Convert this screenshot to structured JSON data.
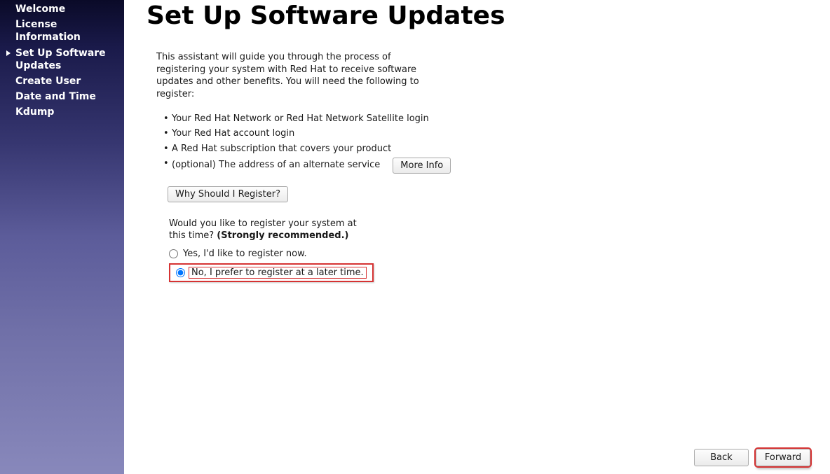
{
  "sidebar": {
    "items": [
      {
        "label": "Welcome"
      },
      {
        "label": "License Information"
      },
      {
        "label": "Set Up Software Updates"
      },
      {
        "label": "Create User"
      },
      {
        "label": "Date and Time"
      },
      {
        "label": "Kdump"
      }
    ]
  },
  "main": {
    "title": "Set Up Software Updates",
    "intro": "This assistant will guide you through the process of registering your system with Red Hat to receive software updates and other benefits. You will need the following to register:",
    "bullets": [
      "Your Red Hat Network or Red Hat Network Satellite login",
      "Your Red Hat account login",
      "A Red Hat subscription that covers your product"
    ],
    "optional_bullet": "(optional) The address of an alternate service",
    "more_info_label": "More Info",
    "why_register_label": "Why Should I Register?",
    "question_text": "Would you like to register your system at this time? ",
    "question_strong": "(Strongly recommended.)",
    "radio_yes": "Yes, I'd like to register now.",
    "radio_no": "No, I prefer to register at a later time."
  },
  "footer": {
    "back_label": "Back",
    "forward_label": "Forward"
  }
}
